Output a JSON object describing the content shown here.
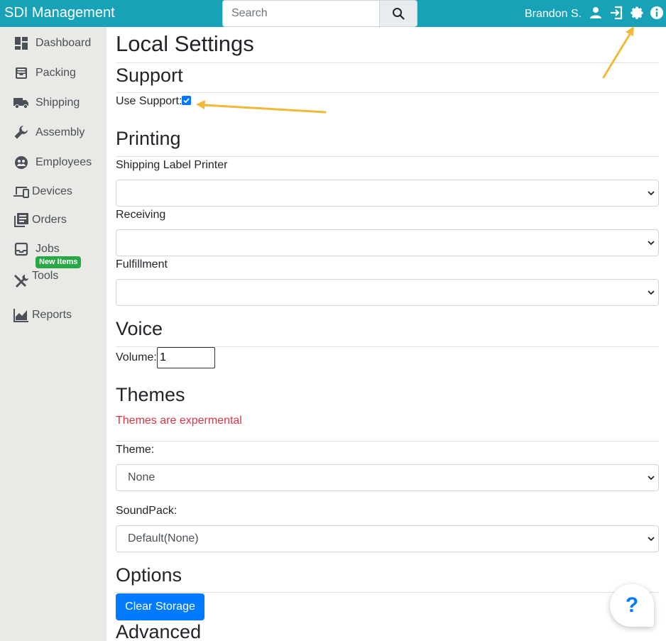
{
  "app": {
    "title": "SDI Management"
  },
  "search": {
    "placeholder": "Search"
  },
  "user": {
    "name": "Brandon S."
  },
  "topbar_icons": [
    "user-icon",
    "sign-out-icon",
    "gear-icon",
    "info-icon"
  ],
  "sidebar": {
    "items": [
      {
        "label": "Dashboard",
        "icon": "dashboard-icon"
      },
      {
        "label": "Packing",
        "icon": "inbox-tray-icon"
      },
      {
        "label": "Shipping",
        "icon": "truck-icon"
      },
      {
        "label": "Assembly",
        "icon": "wrench-icon"
      },
      {
        "label": "Employees",
        "icon": "employees-icon"
      },
      {
        "label": "Devices",
        "icon": "devices-icon"
      },
      {
        "label": "Orders",
        "icon": "orders-icon"
      },
      {
        "label": "Jobs",
        "icon": "jobs-icon"
      },
      {
        "label": "Tools",
        "icon": "tools-icon",
        "badge": "New Items"
      },
      {
        "label": "Reports",
        "icon": "chart-icon"
      }
    ]
  },
  "page": {
    "title": "Local Settings"
  },
  "support": {
    "heading": "Support",
    "use_support_label": "Use Support:",
    "use_support_checked": true
  },
  "printing": {
    "heading": "Printing",
    "shipping_label_printer": {
      "label": "Shipping Label Printer",
      "value": ""
    },
    "receiving": {
      "label": "Receiving",
      "value": ""
    },
    "fulfillment": {
      "label": "Fulfillment",
      "value": ""
    }
  },
  "voice": {
    "heading": "Voice",
    "volume_label": "Volume:",
    "volume_value": "1"
  },
  "themes": {
    "heading": "Themes",
    "warning": "Themes are expermental",
    "theme_label": "Theme:",
    "theme_value": "None",
    "soundpack_label": "SoundPack:",
    "soundpack_value": "Default(None)"
  },
  "options": {
    "heading": "Options",
    "clear_storage_label": "Clear Storage"
  },
  "advanced": {
    "heading": "Advanced"
  },
  "help": {
    "label": "?"
  },
  "colors": {
    "topbar": "#17a2b8",
    "sidebar": "#e9e9e5",
    "primary": "#007bff",
    "danger": "#dc3545",
    "annotation_arrow": "#f0b93a"
  }
}
